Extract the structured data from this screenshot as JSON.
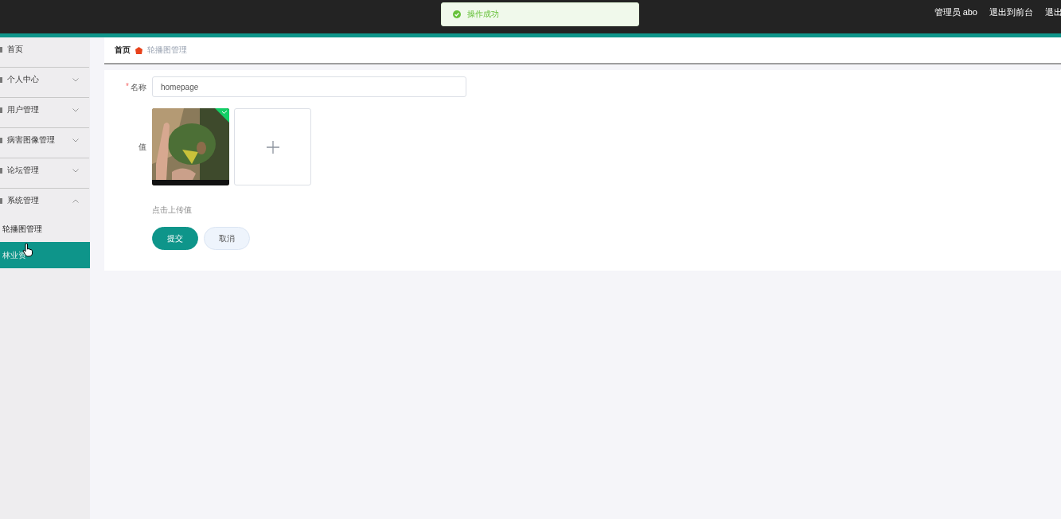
{
  "top_bar": {
    "user": "管理员 abo",
    "links": [
      "退出到前台",
      "退出"
    ]
  },
  "toast": {
    "kind": "success",
    "message": "操作成功"
  },
  "sidebar": {
    "items": [
      {
        "label": "首页",
        "has_children": false
      },
      {
        "label": "个人中心",
        "has_children": true,
        "expanded": false
      },
      {
        "label": "用户管理",
        "has_children": true,
        "expanded": false
      },
      {
        "label": "病害图像管理",
        "has_children": true,
        "expanded": false
      },
      {
        "label": "论坛管理",
        "has_children": true,
        "expanded": false
      },
      {
        "label": "系统管理",
        "has_children": true,
        "expanded": true,
        "children": [
          {
            "label": "轮播图管理",
            "selected": false
          },
          {
            "label": "林业资",
            "selected": true
          }
        ]
      }
    ]
  },
  "breadcrumb": {
    "home": "首页",
    "current": "轮播图管理"
  },
  "form": {
    "fields": [
      {
        "kind": "text",
        "label": "名称",
        "required_mark": "*",
        "value": "homepage"
      },
      {
        "kind": "upload",
        "label": "值",
        "uploaded": true,
        "hint": "点击上传值"
      }
    ],
    "buttons": [
      {
        "label": "提交",
        "primary": true
      },
      {
        "label": "取消",
        "primary": false
      }
    ]
  }
}
